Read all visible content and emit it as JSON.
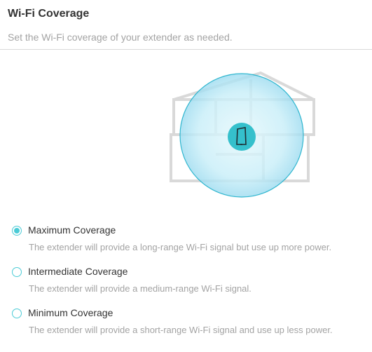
{
  "header": {
    "title": "Wi-Fi Coverage",
    "subtitle": "Set the Wi-Fi coverage of your extender as needed."
  },
  "illustration": {
    "house_icon": "house-outline",
    "coverage_icon": "coverage-circle",
    "extender_icon": "extender-icon",
    "colors": {
      "house": "#d9d9d9",
      "coverage_fill": "#bfeaf5",
      "coverage_edge": "#2fb6cf",
      "extender": "#35c0cc"
    }
  },
  "options": [
    {
      "label": "Maximum Coverage",
      "description": "The extender will provide a long-range Wi-Fi signal but use up more power.",
      "selected": true
    },
    {
      "label": "Intermediate Coverage",
      "description": "The extender will provide a medium-range Wi-Fi signal.",
      "selected": false
    },
    {
      "label": "Minimum Coverage",
      "description": "The extender will provide a short-range Wi-Fi signal and use up less power.",
      "selected": false
    }
  ],
  "accent_color": "#4acbd6"
}
